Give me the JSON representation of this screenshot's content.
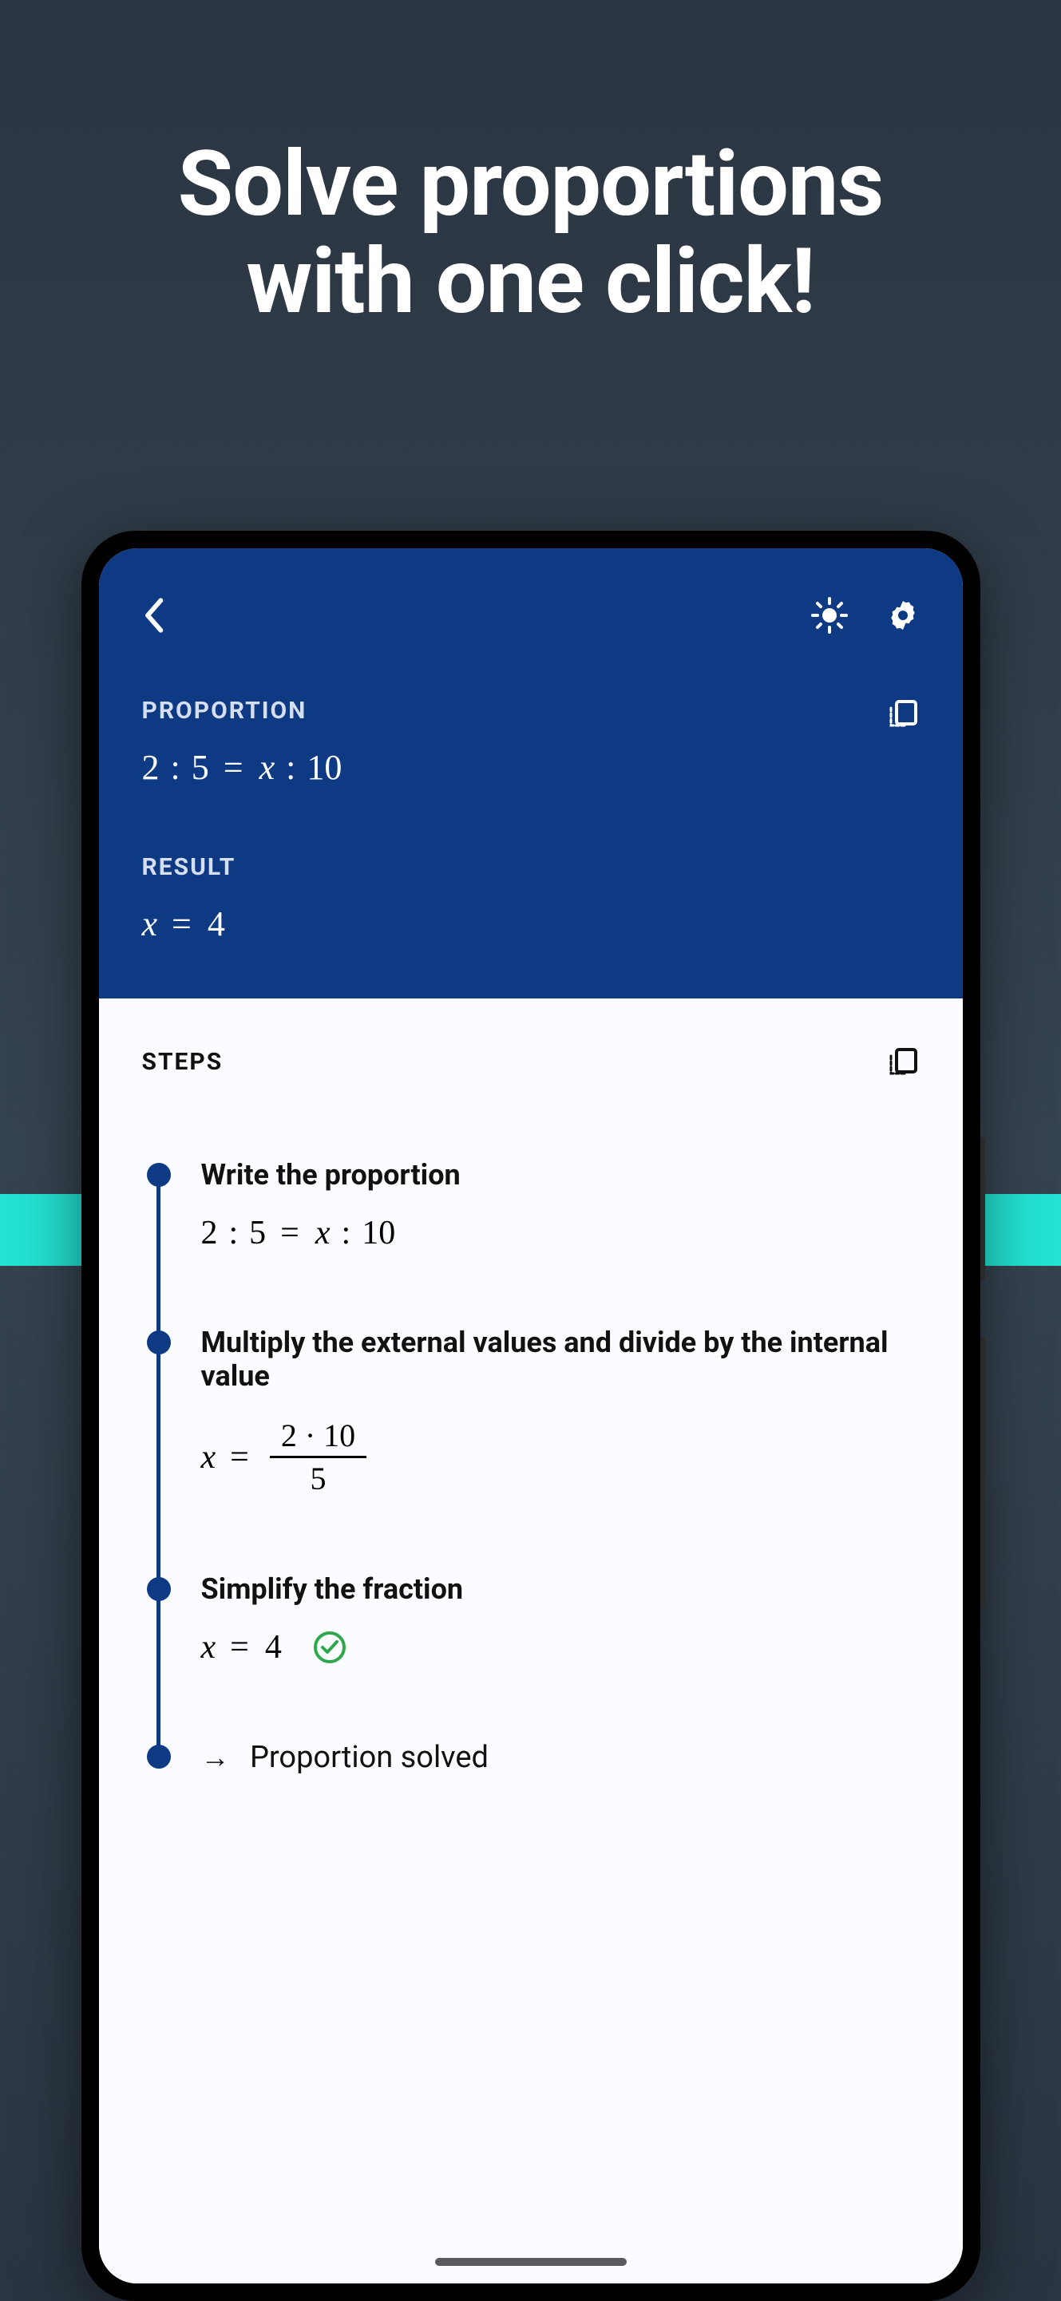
{
  "headline": {
    "line1": "Solve proportions",
    "line2": "with one click!"
  },
  "labels": {
    "proportion": "Proportion",
    "result": "Result",
    "steps": "Steps"
  },
  "input": {
    "lhs_a": "2",
    "lhs_b": "5",
    "rhs_a": "x",
    "rhs_b": "10"
  },
  "result": {
    "var": "x",
    "val": "4"
  },
  "steps": [
    {
      "title": "Write the proportion",
      "type": "proportion",
      "a": "2",
      "b": "5",
      "c": "x",
      "d": "10"
    },
    {
      "title": "Multiply the external values and divide by the internal value",
      "type": "fraction",
      "var": "x",
      "num_a": "2",
      "num_b": "10",
      "den": "5"
    },
    {
      "title": "Simplify the fraction",
      "type": "result",
      "var": "x",
      "val": "4",
      "check": true
    },
    {
      "title": "Proportion solved",
      "type": "final"
    }
  ]
}
